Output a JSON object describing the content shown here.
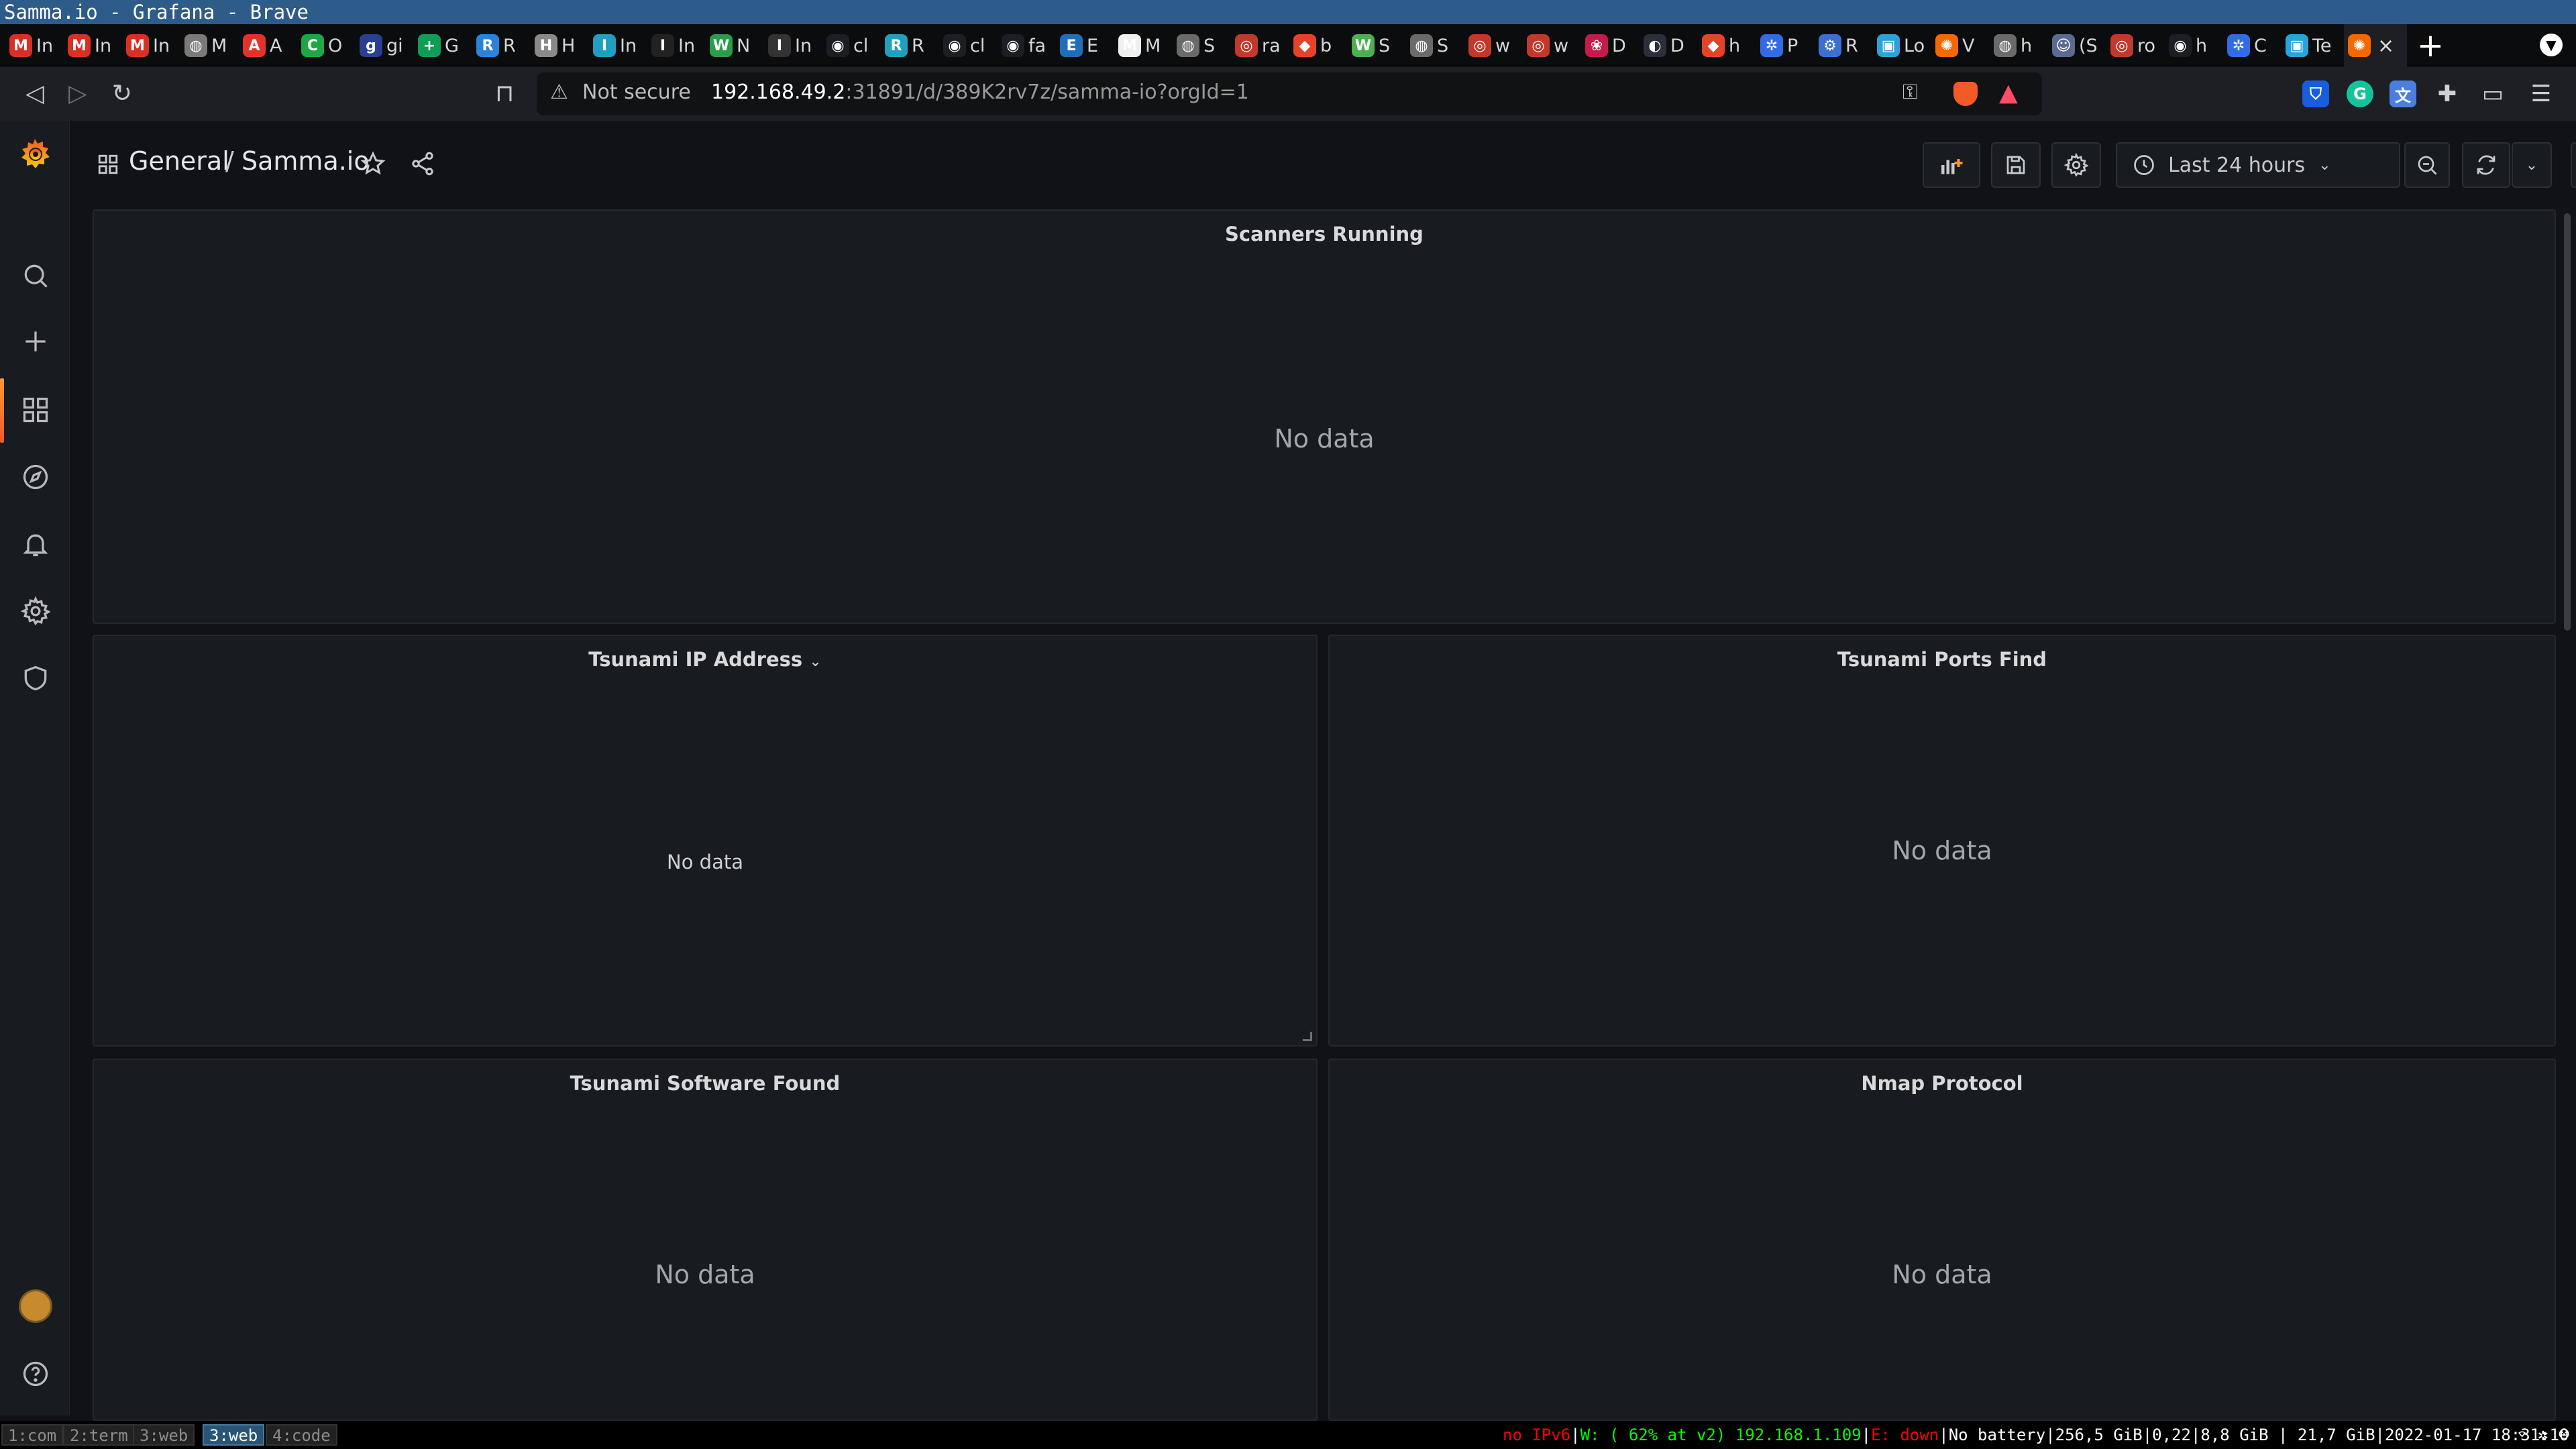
{
  "window": {
    "title": "Samma.io - Grafana - Brave"
  },
  "tabs": [
    {
      "label": "In",
      "icon": "gmail-icon",
      "color": "#d93025",
      "glyph": "M"
    },
    {
      "label": "In",
      "icon": "gmail-icon",
      "color": "#d93025",
      "glyph": "M"
    },
    {
      "label": "In",
      "icon": "gmail-icon",
      "color": "#d93025",
      "glyph": "M"
    },
    {
      "label": "M",
      "icon": "globe-icon",
      "color": "#7a7a7a",
      "glyph": "◍"
    },
    {
      "label": "A",
      "icon": "aliexpress-icon",
      "color": "#e4322b",
      "glyph": "A"
    },
    {
      "label": "O",
      "icon": "o-icon",
      "color": "#1ea845",
      "glyph": "C"
    },
    {
      "label": "gi",
      "icon": "chart-icon",
      "color": "#2a3f8f",
      "glyph": "g"
    },
    {
      "label": "G",
      "icon": "sheets-icon",
      "color": "#0f9d58",
      "glyph": "+"
    },
    {
      "label": "R",
      "icon": "shirt-icon",
      "color": "#2b82d9",
      "glyph": "R"
    },
    {
      "label": "H",
      "icon": "viking-icon",
      "color": "#8a8a8a",
      "glyph": "H"
    },
    {
      "label": "In",
      "icon": "wing-icon",
      "color": "#20a0c0",
      "glyph": "I"
    },
    {
      "label": "In",
      "icon": "dark-icon",
      "color": "#222222",
      "glyph": "I"
    },
    {
      "label": "N",
      "icon": "w-icon",
      "color": "#2a9d4a",
      "glyph": "W"
    },
    {
      "label": "In",
      "icon": "dark-icon",
      "color": "#333333",
      "glyph": "I"
    },
    {
      "label": "cl",
      "icon": "github-icon",
      "color": "#1b1f23",
      "glyph": "◉"
    },
    {
      "label": "R",
      "icon": "wing-icon",
      "color": "#20a0c0",
      "glyph": "R"
    },
    {
      "label": "cl",
      "icon": "github-icon",
      "color": "#1b1f23",
      "glyph": "◉"
    },
    {
      "label": "fa",
      "icon": "github-icon",
      "color": "#1b1f23",
      "glyph": "◉"
    },
    {
      "label": "E",
      "icon": "bird-icon",
      "color": "#1f6fb8",
      "glyph": "E"
    },
    {
      "label": "M",
      "icon": "mail-icon",
      "color": "#f0f0f0",
      "glyph": "M"
    },
    {
      "label": "S",
      "icon": "globe-icon",
      "color": "#6a6a6a",
      "glyph": "◍"
    },
    {
      "label": "ra",
      "icon": "brave-icon",
      "color": "#c0392b",
      "glyph": "◎"
    },
    {
      "label": "b",
      "icon": "gitlab-icon",
      "color": "#e24329",
      "glyph": "◆"
    },
    {
      "label": "S",
      "icon": "w-icon",
      "color": "#4caf50",
      "glyph": "W"
    },
    {
      "label": "S",
      "icon": "globe-icon",
      "color": "#6a6a6a",
      "glyph": "◍"
    },
    {
      "label": "w",
      "icon": "brave-icon",
      "color": "#c0392b",
      "glyph": "◎"
    },
    {
      "label": "w",
      "icon": "brave-icon",
      "color": "#c0392b",
      "glyph": "◎"
    },
    {
      "label": "D",
      "icon": "raspberry-icon",
      "color": "#c51a4a",
      "glyph": "❀"
    },
    {
      "label": "D",
      "icon": "dark-icon",
      "color": "#2a2f3a",
      "glyph": "◐"
    },
    {
      "label": "h",
      "icon": "gitlab-icon",
      "color": "#e24329",
      "glyph": "◆"
    },
    {
      "label": "P",
      "icon": "kubernetes-icon",
      "color": "#326ce5",
      "glyph": "✲"
    },
    {
      "label": "R",
      "icon": "nodes-icon",
      "color": "#3b6fd6",
      "glyph": "⚙"
    },
    {
      "label": "Lo",
      "icon": "box-icon",
      "color": "#2aa3d8",
      "glyph": "▣"
    },
    {
      "label": "V",
      "icon": "grafana-icon",
      "color": "#f46800",
      "glyph": "✺"
    },
    {
      "label": "h",
      "icon": "globe-icon",
      "color": "#6a6a6a",
      "glyph": "◍"
    },
    {
      "label": "(S",
      "icon": "bot-icon",
      "color": "#5a6a90",
      "glyph": "☺"
    },
    {
      "label": "ro",
      "icon": "brave-icon",
      "color": "#c0392b",
      "glyph": "◎"
    },
    {
      "label": "h",
      "icon": "github-icon",
      "color": "#1b1f23",
      "glyph": "◉"
    },
    {
      "label": "C",
      "icon": "kubernetes-icon",
      "color": "#326ce5",
      "glyph": "✲"
    },
    {
      "label": "Te",
      "icon": "box-icon",
      "color": "#2aa3d8",
      "glyph": "▣"
    }
  ],
  "active_tab": {
    "icon": "grafana-icon",
    "color": "#f46800",
    "glyph": "✺",
    "close": "×"
  },
  "new_tab_label": "+",
  "addressbar": {
    "security": "Not secure",
    "host": "192.168.49.2",
    "path": ":31891/d/389K2rv7z/samma-io?orgId=1"
  },
  "dashboard": {
    "folder": "General",
    "separator": "/",
    "title": "Samma.io",
    "time_range": "Last 24 hours"
  },
  "panels": [
    {
      "title": "Scanners Running",
      "empty": "No data"
    },
    {
      "title": "Tsunami IP Address",
      "empty": "No data"
    },
    {
      "title": "Tsunami Ports Find",
      "empty": "No data"
    },
    {
      "title": "Tsunami Software Found",
      "empty": "No data"
    },
    {
      "title": "Nmap Protocol",
      "empty": "No data"
    }
  ],
  "workspaces": [
    {
      "label": "1:com"
    },
    {
      "label": "2:term"
    },
    {
      "label": "3:web"
    },
    {
      "label": "3:web"
    },
    {
      "label": "4:code"
    }
  ],
  "status": {
    "ipv6": "no IPv6",
    "wifi": "W: ( 62% at v2) 192.168.1.109",
    "eth": "E: down",
    "battery": "No battery",
    "disk": "256,5 GiB",
    "load": "0,22",
    "mem": "8,8 GiB",
    "swap": "21,7 GiB",
    "datetime": "2022-01-17 18:31:10"
  }
}
